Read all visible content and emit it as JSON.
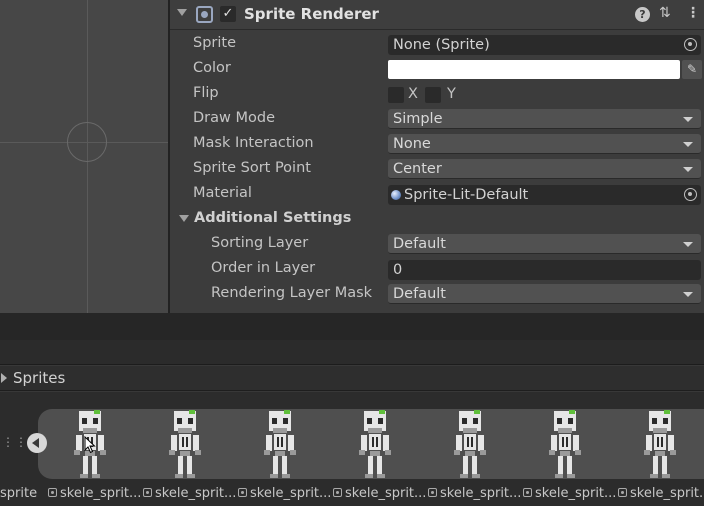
{
  "component": {
    "title": "Sprite Renderer",
    "enabled_mark": "✓",
    "help_icon": "question-mark-icon",
    "preset_icon": "sliders-icon",
    "menu_icon": "kebab-menu-icon",
    "help_glyph": "?",
    "preset_glyph": "⇅",
    "menu_glyph": "⋮"
  },
  "properties": {
    "sprite": {
      "label": "Sprite",
      "value": "None (Sprite)"
    },
    "color": {
      "label": "Color",
      "value": "#ffffff"
    },
    "flip": {
      "label": "Flip",
      "x_label": "X",
      "y_label": "Y"
    },
    "draw_mode": {
      "label": "Draw Mode",
      "value": "Simple"
    },
    "mask_interaction": {
      "label": "Mask Interaction",
      "value": "None"
    },
    "sprite_sort_point": {
      "label": "Sprite Sort Point",
      "value": "Center"
    },
    "material": {
      "label": "Material",
      "value": "Sprite-Lit-Default"
    }
  },
  "additional_settings": {
    "title": "Additional Settings",
    "sorting_layer": {
      "label": "Sorting Layer",
      "value": "Default"
    },
    "order_in_layer": {
      "label": "Order in Layer",
      "value": "0"
    },
    "rendering_layer_mask": {
      "label": "Rendering Layer Mask",
      "value": "Default"
    }
  },
  "sprites_panel": {
    "title": "Sprites",
    "first_label": "sprite",
    "frame_labels": [
      "skele_sprit...",
      "skele_sprit...",
      "skele_sprit...",
      "skele_sprit...",
      "skele_sprit...",
      "skele_sprit...",
      "skele_sprit..."
    ]
  },
  "colors": {
    "skeleton_bone": "#e6e6e6",
    "skeleton_shadow": "#9a9a9a",
    "skeleton_dark": "#2a2a2a",
    "skeleton_moss": "#5fbf3a"
  }
}
